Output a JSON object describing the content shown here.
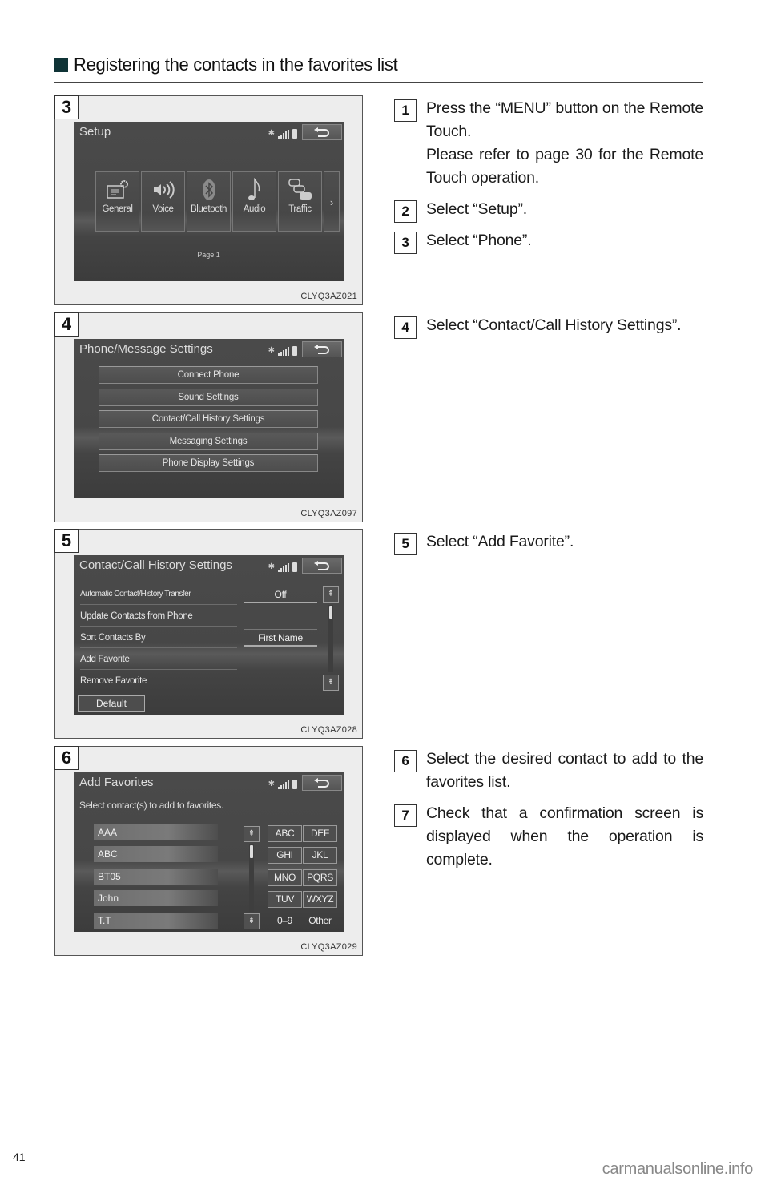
{
  "section": {
    "title": "Registering the contacts in the favorites list"
  },
  "panels": [
    {
      "number": "3",
      "code": "CLYQ3AZ021",
      "screen": {
        "title": "Setup",
        "tiles": [
          {
            "label": "General",
            "icon": "general-settings-icon"
          },
          {
            "label": "Voice",
            "icon": "voice-icon"
          },
          {
            "label": "Bluetooth",
            "icon": "bluetooth-icon"
          },
          {
            "label": "Audio",
            "icon": "music-note-icon"
          },
          {
            "label": "Traffic",
            "icon": "traffic-icon"
          }
        ],
        "more_arrow": "›",
        "page_label": "Page 1"
      }
    },
    {
      "number": "4",
      "code": "CLYQ3AZ097",
      "screen": {
        "title": "Phone/Message Settings",
        "items": [
          "Connect Phone",
          "Sound Settings",
          "Contact/Call History Settings",
          "Messaging Settings",
          "Phone Display Settings"
        ]
      }
    },
    {
      "number": "5",
      "code": "CLYQ3AZ028",
      "screen": {
        "title": "Contact/Call History Settings",
        "rows": [
          {
            "label": "Automatic Contact/History Transfer",
            "value": "Off"
          },
          {
            "label": "Update Contacts from Phone",
            "value": ""
          },
          {
            "label": "Sort Contacts By",
            "value": "First Name"
          },
          {
            "label": "Add Favorite",
            "value": ""
          },
          {
            "label": "Remove Favorite",
            "value": ""
          }
        ],
        "default_label": "Default",
        "scroll_up": "⇞",
        "scroll_down": "⇟"
      }
    },
    {
      "number": "6",
      "code": "CLYQ3AZ029",
      "screen": {
        "title": "Add Favorites",
        "subtitle": "Select contact(s) to add to favorites.",
        "contacts": [
          "AAA",
          "ABC",
          "BT05",
          "John",
          "T.T"
        ],
        "keys": [
          "ABC",
          "DEF",
          "GHI",
          "JKL",
          "MNO",
          "PQRS",
          "TUV",
          "WXYZ",
          "0–9",
          "Other"
        ],
        "scroll_up": "⇞",
        "scroll_down": "⇟"
      }
    }
  ],
  "steps": [
    {
      "number": "1",
      "lines": [
        "Press the “MENU” button on the Remote Touch.",
        "Please refer to page 30 for the Remote Touch operation."
      ]
    },
    {
      "number": "2",
      "lines": [
        "Select “Setup”."
      ]
    },
    {
      "number": "3",
      "lines": [
        "Select “Phone”."
      ]
    },
    {
      "number": "4",
      "lines": [
        "Select “Contact/Call History Settings”."
      ]
    },
    {
      "number": "5",
      "lines": [
        "Select “Add Favorite”."
      ]
    },
    {
      "number": "6",
      "lines": [
        "Select the desired contact to add to the favorites list."
      ]
    },
    {
      "number": "7",
      "lines": [
        "Check that a confirmation screen is displayed when the operation is complete."
      ]
    }
  ],
  "footer": {
    "page_number": "41",
    "watermark": "carmanualsonline.info"
  },
  "colors": {
    "heading_square": "#0f3336",
    "screen_bg": "#4a4a4a",
    "screen_text": "#e6e6e6"
  }
}
